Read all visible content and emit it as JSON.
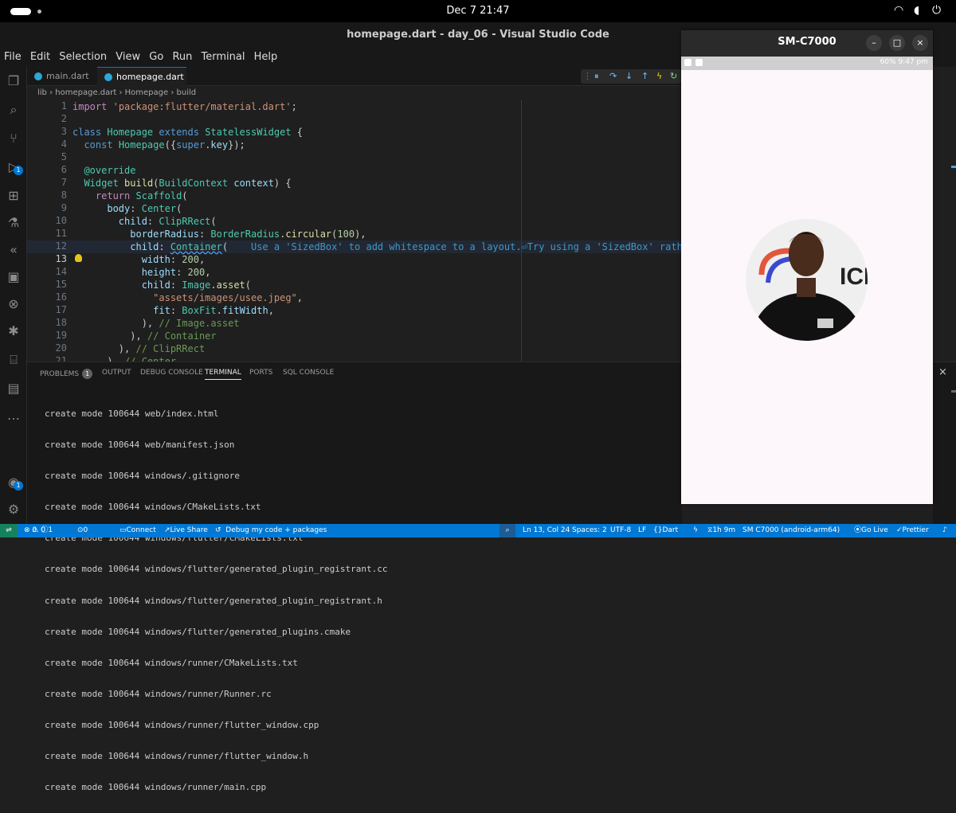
{
  "system_bar": {
    "clock": "Dec 7  21:47"
  },
  "window": {
    "title": "homepage.dart - day_06 - Visual Studio Code"
  },
  "menu": [
    "File",
    "Edit",
    "Selection",
    "View",
    "Go",
    "Run",
    "Terminal",
    "Help"
  ],
  "activity_badges": {
    "run_debug": "1",
    "accounts": "1"
  },
  "tabs": [
    {
      "label": "main.dart"
    },
    {
      "label": "homepage.dart"
    }
  ],
  "breadcrumb": {
    "folder": "lib",
    "file": "homepage.dart",
    "class": "Homepage",
    "method": "build"
  },
  "editor": {
    "line_numbers": [
      "1",
      "2",
      "3",
      "4",
      "5",
      "6",
      "7",
      "8",
      "9",
      "10",
      "11",
      "12",
      "13",
      "14",
      "15",
      "16",
      "17",
      "18",
      "19",
      "20",
      "21"
    ],
    "current_line": "13"
  },
  "panel": {
    "tabs": [
      "PROBLEMS",
      "OUTPUT",
      "DEBUG CONSOLE",
      "TERMINAL",
      "PORTS",
      "SQL CONSOLE"
    ],
    "problems_count": "1",
    "terminal_lines": [
      "create mode 100644 web/index.html",
      "create mode 100644 web/manifest.json",
      "create mode 100644 windows/.gitignore",
      "create mode 100644 windows/CMakeLists.txt",
      "create mode 100644 windows/flutter/CMakeLists.txt",
      "create mode 100644 windows/flutter/generated_plugin_registrant.cc",
      "create mode 100644 windows/flutter/generated_plugin_registrant.h",
      "create mode 100644 windows/flutter/generated_plugins.cmake",
      "create mode 100644 windows/runner/CMakeLists.txt",
      "create mode 100644 windows/runner/Runner.rc",
      "create mode 100644 windows/runner/flutter_window.cpp",
      "create mode 100644 windows/runner/flutter_window.h",
      "create mode 100644 windows/runner/main.cpp"
    ]
  },
  "status_bar": {
    "errors": "0",
    "warnings": "0",
    "info": "1",
    "ports": "0",
    "connect": "Connect",
    "live_share": "Live Share",
    "debug": "Debug my code + packages",
    "position": "Ln 13, Col 24",
    "spaces": "Spaces: 2",
    "encoding": "UTF-8",
    "eol": "LF",
    "language": "Dart",
    "time": "1h 9m",
    "device": "SM C7000 (android-arm64)",
    "go_live": "Go Live",
    "prettier": "Prettier"
  },
  "emulator": {
    "title": "SM-C7000",
    "phone_status": "60%  9:47 pm"
  },
  "colors": {
    "accent": "#0078d4",
    "remote": "#16825d",
    "editor_bg": "#1f1f1f"
  }
}
